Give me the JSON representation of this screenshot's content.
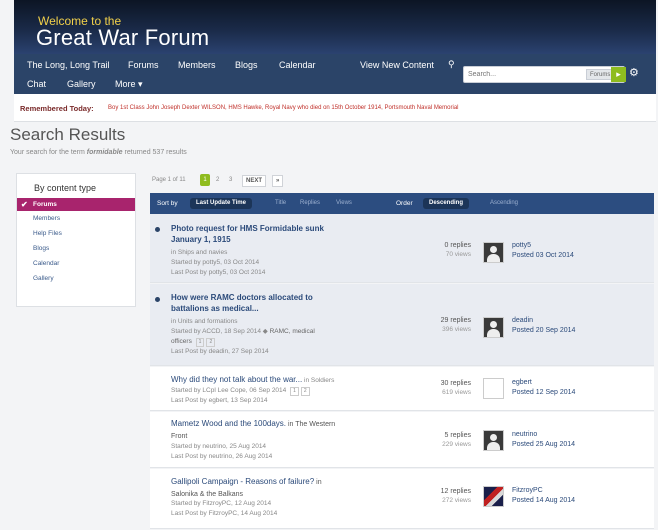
{
  "header": {
    "welcome": "Welcome to the",
    "site_name": "Great War Forum"
  },
  "nav": {
    "items": [
      "The Long, Long Trail",
      "Forums",
      "Members",
      "Blogs",
      "Calendar",
      "View New Content"
    ],
    "items2": [
      "Chat",
      "Gallery",
      "More ▾"
    ],
    "pin": "⚲",
    "search_placeholder": "Search...",
    "search_scope": "Forums",
    "search_go": "▸",
    "gear": "⚙"
  },
  "remembered": {
    "label": "Remembered Today:",
    "text": "Boy 1st Class John Joseph Dexter WILSON, HMS Hawke, Royal Navy who died on 15th October 1914, Portsmouth Naval Memorial"
  },
  "page": {
    "title": "Search Results",
    "sub_pre": "Your search for the term ",
    "term": "formidable",
    "sub_post": " returned 537 results"
  },
  "sidebar": {
    "heading": "By content type",
    "items": [
      "Forums",
      "Members",
      "Help Files",
      "Blogs",
      "Calendar",
      "Gallery"
    ],
    "check": "✔"
  },
  "pager": {
    "label": "Page 1 of 11",
    "current": "1",
    "p2": "2",
    "p3": "3",
    "next": "NEXT",
    "last": "»"
  },
  "sort": {
    "label": "Sort by",
    "active": "Last Update Time",
    "opt1": "Title",
    "opt2": "Replies",
    "opt3": "Views",
    "order": "Order",
    "desc": "Descending",
    "asc": "Ascending"
  },
  "results": [
    {
      "title1": "Photo request for HMS Formidable sunk",
      "title2": "January 1, 1915",
      "in": "in Ships and navies",
      "started": "Started by potty5, 03 Oct 2014",
      "last": "Last Post by potty5, 03 Oct 2014",
      "replies": "0 replies",
      "views": "70 views",
      "poster": "potty5",
      "posted": "Posted 03 Oct 2014"
    },
    {
      "title1": "How were RAMC doctors allocated to",
      "title2": "battalions as medical...",
      "in": "in Units and formations",
      "started": "Started by ACCD, 18 Sep 2014",
      "tag": "RAMC, medical",
      "started2": "officers",
      "pg1": "1",
      "pg2": "2",
      "last": "Last Post by deadin, 27 Sep 2014",
      "replies": "29 replies",
      "views": "396 views",
      "poster": "deadin",
      "posted": "Posted 20 Sep 2014"
    },
    {
      "title1": "Why did they not talk about the war...",
      "in_inline": " in Soldiers",
      "started": "Started by LCpl Lee Cope, 06 Sep 2014",
      "pg1": "1",
      "pg2": "2",
      "last": "Last Post by egbert, 13 Sep 2014",
      "replies": "30 replies",
      "views": "619 views",
      "poster": "egbert",
      "posted": "Posted 12 Sep 2014"
    },
    {
      "title1": "Mametz Wood and the 100days.",
      "in_inline": " in The Western",
      "in2": "Front",
      "started": "Started by neutrino, 25 Aug 2014",
      "last": "Last Post by neutrino, 26 Aug 2014",
      "replies": "5 replies",
      "views": "229 views",
      "poster": "neutrino",
      "posted": "Posted 25 Aug 2014"
    },
    {
      "title1": "Gallipoli Campaign - Reasons of failure?",
      "in_inline": " in",
      "in2": "Salonika & the Balkans",
      "started": "Started by FitzroyPC, 12 Aug 2014",
      "last": "Last Post by FitzroyPC, 14 Aug 2014",
      "replies": "12 replies",
      "views": "272 views",
      "poster": "FitzroyPC",
      "posted": "Posted 14 Aug 2014"
    }
  ]
}
